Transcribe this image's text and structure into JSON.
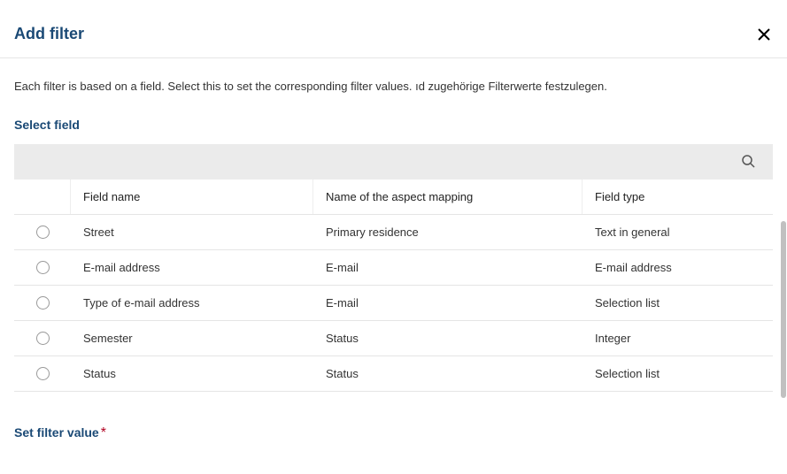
{
  "dialog": {
    "title": "Add filter",
    "description": "Each filter is based on a field. Select this to set the corresponding filter values. ıd zugehörige Filterwerte festzulegen."
  },
  "sections": {
    "select_field": "Select field",
    "set_filter_value": "Set filter value",
    "required_mark": "*"
  },
  "table": {
    "headers": {
      "field_name": "Field name",
      "aspect_mapping": "Name of the aspect mapping",
      "field_type": "Field type"
    },
    "rows": [
      {
        "field_name": "Street",
        "aspect": "Primary residence",
        "type": "Text in general"
      },
      {
        "field_name": "E-mail address",
        "aspect": "E-mail",
        "type": "E-mail address"
      },
      {
        "field_name": "Type of e-mail address",
        "aspect": "E-mail",
        "type": "Selection list"
      },
      {
        "field_name": "Semester",
        "aspect": "Status",
        "type": "Integer"
      },
      {
        "field_name": "Status",
        "aspect": "Status",
        "type": "Selection list"
      }
    ]
  },
  "search": {
    "placeholder": ""
  }
}
